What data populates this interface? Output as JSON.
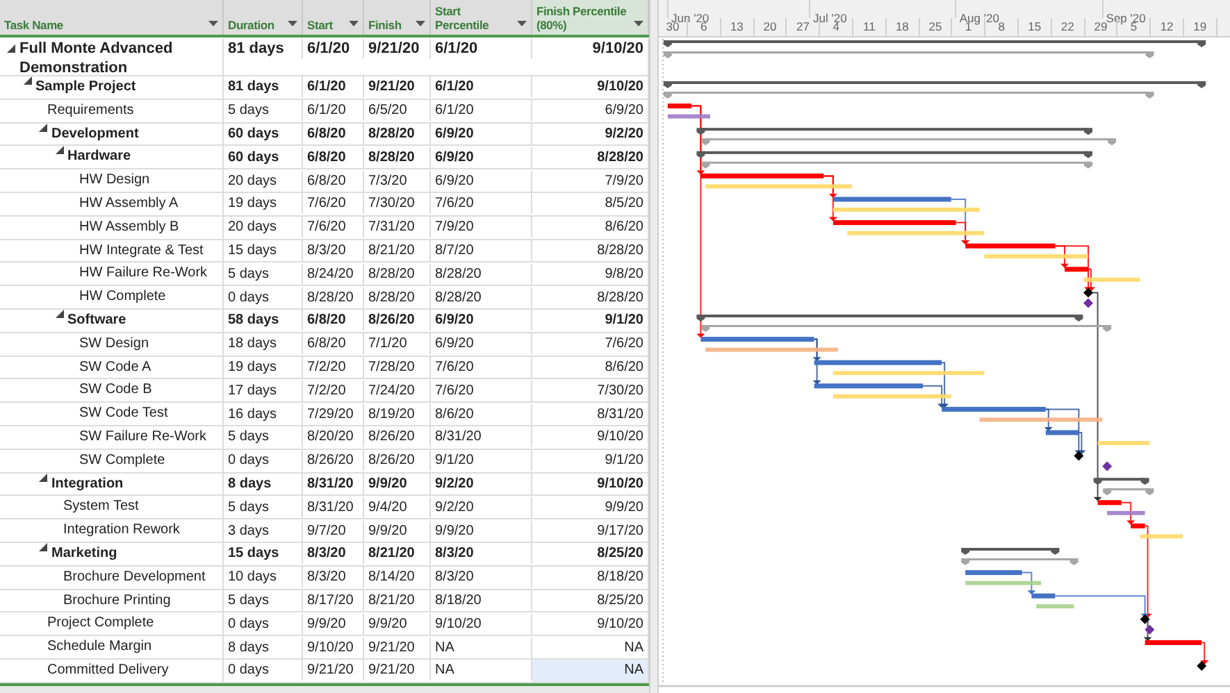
{
  "columns": [
    {
      "label": "Task Name"
    },
    {
      "label": "Duration"
    },
    {
      "label": "Start"
    },
    {
      "label": "Finish"
    },
    {
      "label": "Start Percentile"
    },
    {
      "label": "Finish Percentile (80%)"
    }
  ],
  "timeline": {
    "months": [
      "Jun '20",
      "Jul '20",
      "Aug '20",
      "Sep '20"
    ],
    "weeks": [
      "30",
      "6",
      "13",
      "20",
      "27",
      "4",
      "11",
      "18",
      "25",
      "1",
      "8",
      "15",
      "22",
      "29",
      "5",
      "12",
      "19"
    ]
  },
  "tasks": [
    {
      "name": "Full Monte Advanced Demonstration",
      "duration": "81 days",
      "start": "6/1/20",
      "finish": "9/21/20",
      "start_percentile": "6/1/20",
      "finish_percentile": "9/10/20",
      "expanded": true,
      "selected": false,
      "children": [
        {
          "name": "Sample Project",
          "duration": "81 days",
          "start": "6/1/20",
          "finish": "9/21/20",
          "start_percentile": "6/1/20",
          "finish_percentile": "9/10/20",
          "expanded": true,
          "selected": false,
          "children": [
            {
              "name": "Requirements",
              "duration": "5 days",
              "start": "6/1/20",
              "finish": "6/5/20",
              "start_percentile": "6/1/20",
              "finish_percentile": "6/9/20",
              "selected": false
            },
            {
              "name": "Development",
              "duration": "60 days",
              "start": "6/8/20",
              "finish": "8/28/20",
              "start_percentile": "6/9/20",
              "finish_percentile": "9/2/20",
              "expanded": true,
              "selected": false,
              "children": [
                {
                  "name": "Hardware",
                  "duration": "60 days",
                  "start": "6/8/20",
                  "finish": "8/28/20",
                  "start_percentile": "6/9/20",
                  "finish_percentile": "8/28/20",
                  "expanded": true,
                  "selected": false,
                  "children": [
                    {
                      "name": "HW Design",
                      "duration": "20 days",
                      "start": "6/8/20",
                      "finish": "7/3/20",
                      "start_percentile": "6/9/20",
                      "finish_percentile": "7/9/20",
                      "selected": false
                    },
                    {
                      "name": "HW Assembly A",
                      "duration": "19 days",
                      "start": "7/6/20",
                      "finish": "7/30/20",
                      "start_percentile": "7/6/20",
                      "finish_percentile": "8/5/20",
                      "selected": false
                    },
                    {
                      "name": "HW Assembly B",
                      "duration": "20 days",
                      "start": "7/6/20",
                      "finish": "7/31/20",
                      "start_percentile": "7/9/20",
                      "finish_percentile": "8/6/20",
                      "selected": false
                    },
                    {
                      "name": "HW Integrate & Test",
                      "duration": "15 days",
                      "start": "8/3/20",
                      "finish": "8/21/20",
                      "start_percentile": "8/7/20",
                      "finish_percentile": "8/28/20",
                      "selected": false
                    },
                    {
                      "name": "HW Failure Re-Work",
                      "duration": "5 days",
                      "start": "8/24/20",
                      "finish": "8/28/20",
                      "start_percentile": "8/28/20",
                      "finish_percentile": "9/8/20",
                      "selected": false
                    },
                    {
                      "name": "HW Complete",
                      "duration": "0 days",
                      "start": "8/28/20",
                      "finish": "8/28/20",
                      "start_percentile": "8/28/20",
                      "finish_percentile": "8/28/20",
                      "selected": false
                    }
                  ]
                },
                {
                  "name": "Software",
                  "duration": "58 days",
                  "start": "6/8/20",
                  "finish": "8/26/20",
                  "start_percentile": "6/9/20",
                  "finish_percentile": "9/1/20",
                  "expanded": true,
                  "selected": false,
                  "children": [
                    {
                      "name": "SW Design",
                      "duration": "18 days",
                      "start": "6/8/20",
                      "finish": "7/1/20",
                      "start_percentile": "6/9/20",
                      "finish_percentile": "7/6/20",
                      "selected": false
                    },
                    {
                      "name": "SW Code A",
                      "duration": "19 days",
                      "start": "7/2/20",
                      "finish": "7/28/20",
                      "start_percentile": "7/6/20",
                      "finish_percentile": "8/6/20",
                      "selected": false
                    },
                    {
                      "name": "SW Code B",
                      "duration": "17 days",
                      "start": "7/2/20",
                      "finish": "7/24/20",
                      "start_percentile": "7/6/20",
                      "finish_percentile": "7/30/20",
                      "selected": false
                    },
                    {
                      "name": "SW Code Test",
                      "duration": "16 days",
                      "start": "7/29/20",
                      "finish": "8/19/20",
                      "start_percentile": "8/6/20",
                      "finish_percentile": "8/31/20",
                      "selected": false
                    },
                    {
                      "name": "SW Failure Re-Work",
                      "duration": "5 days",
                      "start": "8/20/20",
                      "finish": "8/26/20",
                      "start_percentile": "8/31/20",
                      "finish_percentile": "9/10/20",
                      "selected": false
                    },
                    {
                      "name": "SW Complete",
                      "duration": "0 days",
                      "start": "8/26/20",
                      "finish": "8/26/20",
                      "start_percentile": "9/1/20",
                      "finish_percentile": "9/1/20",
                      "selected": false
                    }
                  ]
                }
              ]
            },
            {
              "name": "Integration",
              "duration": "8 days",
              "start": "8/31/20",
              "finish": "9/9/20",
              "start_percentile": "9/2/20",
              "finish_percentile": "9/10/20",
              "expanded": true,
              "selected": false,
              "children": [
                {
                  "name": "System Test",
                  "duration": "5 days",
                  "start": "8/31/20",
                  "finish": "9/4/20",
                  "start_percentile": "9/2/20",
                  "finish_percentile": "9/9/20",
                  "selected": false
                },
                {
                  "name": "Integration Rework",
                  "duration": "3 days",
                  "start": "9/7/20",
                  "finish": "9/9/20",
                  "start_percentile": "9/9/20",
                  "finish_percentile": "9/17/20",
                  "selected": false
                }
              ]
            },
            {
              "name": "Marketing",
              "duration": "15 days",
              "start": "8/3/20",
              "finish": "8/21/20",
              "start_percentile": "8/3/20",
              "finish_percentile": "8/25/20",
              "expanded": true,
              "selected": false,
              "children": [
                {
                  "name": "Brochure Development",
                  "duration": "10 days",
                  "start": "8/3/20",
                  "finish": "8/14/20",
                  "start_percentile": "8/3/20",
                  "finish_percentile": "8/18/20",
                  "selected": false
                },
                {
                  "name": "Brochure Printing",
                  "duration": "5 days",
                  "start": "8/17/20",
                  "finish": "8/21/20",
                  "start_percentile": "8/18/20",
                  "finish_percentile": "8/25/20",
                  "selected": false
                }
              ]
            },
            {
              "name": "Project Complete",
              "duration": "0 days",
              "start": "9/9/20",
              "finish": "9/9/20",
              "start_percentile": "9/10/20",
              "finish_percentile": "9/10/20",
              "selected": false
            },
            {
              "name": "Schedule Margin",
              "duration": "8 days",
              "start": "9/10/20",
              "finish": "9/21/20",
              "start_percentile": "NA",
              "finish_percentile": "NA",
              "selected": false
            },
            {
              "name": "Committed Delivery",
              "duration": "0 days",
              "start": "9/21/20",
              "finish": "9/21/20",
              "start_percentile": "NA",
              "finish_percentile": "NA",
              "selected": true
            }
          ]
        }
      ]
    }
  ]
}
